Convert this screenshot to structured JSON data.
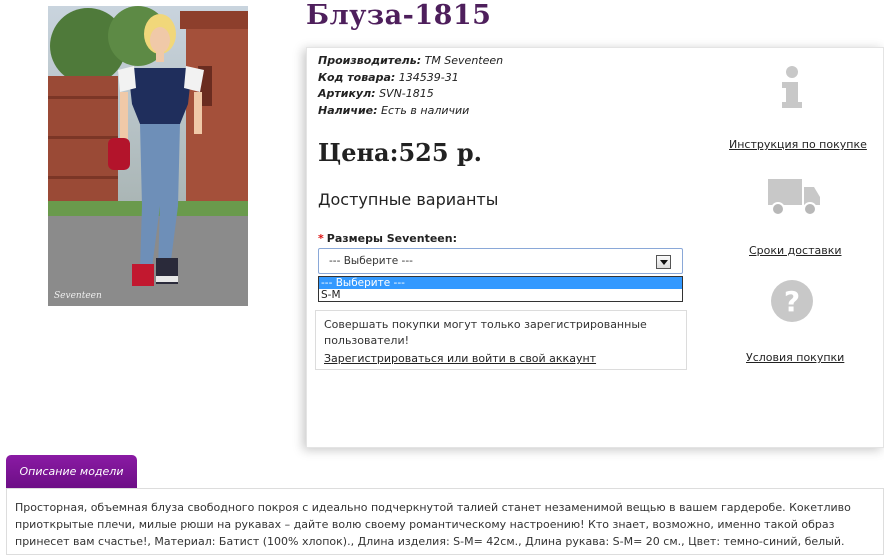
{
  "product": {
    "title": "Блуза-1815",
    "photo_signature": "Seventeen"
  },
  "meta": {
    "manufacturer_label": "Производитель:",
    "manufacturer_value": "TM Seventeen",
    "code_label": "Код товара:",
    "code_value": "134539-31",
    "article_label": "Артикул:",
    "article_value": "SVN-1815",
    "stock_label": "Наличие:",
    "stock_value": "Есть в наличии"
  },
  "price": {
    "label": "Цена:",
    "value": "525 р."
  },
  "variants": {
    "heading": "Доступные варианты",
    "required_mark": "*",
    "size_label": "Размеры Seventeen:",
    "selected": "--- Выберите ---",
    "options": [
      "--- Выберите ---",
      "S-M"
    ]
  },
  "notice": {
    "text": "Совершать покупки могут только зарегистрированные пользователи!",
    "link": "Зарегистрироваться или войти в свой аккаунт"
  },
  "side_links": {
    "instructions": "Инструкция по покупке",
    "delivery": "Сроки доставки",
    "terms": "Условия покупки"
  },
  "icons": {
    "info": "info-icon",
    "truck": "truck-icon",
    "question": "question-icon"
  },
  "description": {
    "tab_label": "Описание модели",
    "text": "Просторная, объемная блуза свободного покроя с идеально подчеркнутой талией станет незаменимой вещью в вашем гардеробе. Кокетливо приоткрытые плечи, милые рюши на рукавах – дайте волю своему романтическому настроению! Кто знает, возможно, именно такой образ принесет вам счастье!, Материал: Батист (100% хлопок)., Длина изделия: S-M= 42см., Длина рукава: S-M= 20 см., Цвет: темно-синий, белый."
  },
  "colors": {
    "title": "#4e1f5c",
    "tab": "#7b1496",
    "select_highlight": "#3399ff",
    "icon_gray": "#c8c8c8"
  }
}
